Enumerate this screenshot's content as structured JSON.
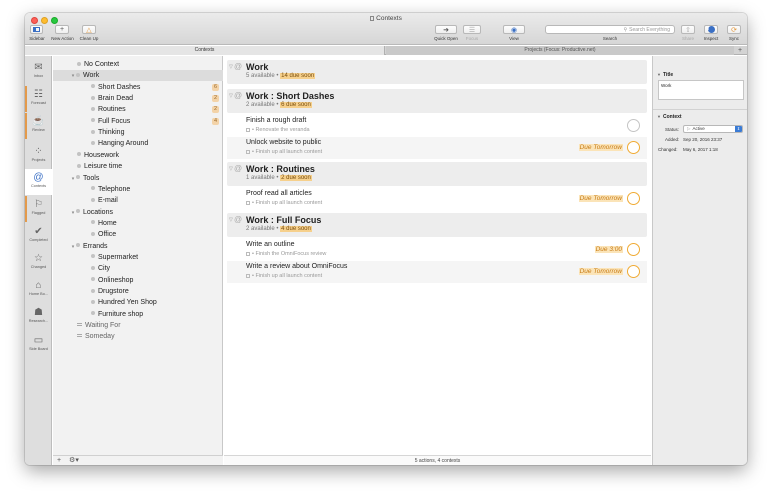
{
  "window": {
    "title": "Contexts"
  },
  "toolbar": {
    "sidebar_label": "Sidebar",
    "new_action_label": "New Action",
    "clean_up_label": "Clean Up",
    "quick_open_label": "Quick Open",
    "focus_label": "Focus",
    "view_label": "View",
    "search_placeholder": "Search Everything",
    "search_label": "Search",
    "share_label": "Share",
    "inspect_label": "Inspect",
    "sync_label": "Sync"
  },
  "tabs": {
    "active": "Contexts",
    "inactive": "Projects (Focus: Productive.net)"
  },
  "perspectives": [
    {
      "label": "Inbox",
      "icon": "inbox-icon",
      "glyph": "✉"
    },
    {
      "label": "Forecast",
      "icon": "forecast-icon",
      "glyph": "☷"
    },
    {
      "label": "Review",
      "icon": "review-icon",
      "glyph": "☕"
    },
    {
      "label": "Projects",
      "icon": "projects-icon",
      "glyph": "⁘"
    },
    {
      "label": "Contexts",
      "icon": "contexts-icon",
      "glyph": "@"
    },
    {
      "label": "Flagged",
      "icon": "flag-icon",
      "glyph": "⚐"
    },
    {
      "label": "Completed",
      "icon": "completed-icon",
      "glyph": "✔"
    },
    {
      "label": "Changed",
      "icon": "changed-icon",
      "glyph": "☆"
    },
    {
      "label": "Home Bo...",
      "icon": "home-icon",
      "glyph": "⌂"
    },
    {
      "label": "Research...",
      "icon": "research-icon",
      "glyph": "☗"
    },
    {
      "label": "Side Board",
      "icon": "sideboard-icon",
      "glyph": "▭"
    }
  ],
  "sidebar": {
    "items": [
      {
        "label": "No Context",
        "level": 0,
        "kind": "bullet",
        "count": ""
      },
      {
        "label": "Work",
        "level": 0,
        "kind": "tri",
        "count": ""
      },
      {
        "label": "Short Dashes",
        "level": 1,
        "kind": "bullet",
        "count": "6"
      },
      {
        "label": "Brain Dead",
        "level": 1,
        "kind": "bullet",
        "count": "2"
      },
      {
        "label": "Routines",
        "level": 1,
        "kind": "bullet",
        "count": "2"
      },
      {
        "label": "Full Focus",
        "level": 1,
        "kind": "bullet",
        "count": "4"
      },
      {
        "label": "Thinking",
        "level": 1,
        "kind": "bullet",
        "count": ""
      },
      {
        "label": "Hanging Around",
        "level": 1,
        "kind": "bullet",
        "count": ""
      },
      {
        "label": "Housework",
        "level": 0,
        "kind": "bullet",
        "count": ""
      },
      {
        "label": "Leisure time",
        "level": 0,
        "kind": "bullet",
        "count": ""
      },
      {
        "label": "Tools",
        "level": 0,
        "kind": "tri",
        "count": ""
      },
      {
        "label": "Telephone",
        "level": 1,
        "kind": "bullet",
        "count": ""
      },
      {
        "label": "E-mail",
        "level": 1,
        "kind": "bullet",
        "count": ""
      },
      {
        "label": "Locations",
        "level": 0,
        "kind": "tri",
        "count": ""
      },
      {
        "label": "Home",
        "level": 1,
        "kind": "bullet",
        "count": ""
      },
      {
        "label": "Office",
        "level": 1,
        "kind": "bullet",
        "count": ""
      },
      {
        "label": "Errands",
        "level": 0,
        "kind": "tri",
        "count": ""
      },
      {
        "label": "Supermarket",
        "level": 1,
        "kind": "bullet",
        "count": ""
      },
      {
        "label": "City",
        "level": 1,
        "kind": "bullet",
        "count": ""
      },
      {
        "label": "Onlineshop",
        "level": 1,
        "kind": "bullet",
        "count": ""
      },
      {
        "label": "Drugstore",
        "level": 1,
        "kind": "bullet",
        "count": ""
      },
      {
        "label": "Hundred Yen Shop",
        "level": 1,
        "kind": "bullet",
        "count": ""
      },
      {
        "label": "Furniture shop",
        "level": 1,
        "kind": "bullet",
        "count": ""
      },
      {
        "label": "Waiting For",
        "level": 0,
        "kind": "square",
        "count": ""
      },
      {
        "label": "Someday",
        "level": 0,
        "kind": "square",
        "count": ""
      }
    ],
    "footer_add": "+",
    "footer_gear": "⚙▾"
  },
  "main": {
    "groups": [
      {
        "title": "Work",
        "available": "5 available •",
        "due": "14 due soon",
        "actions": []
      },
      {
        "title": "Work : Short Dashes",
        "available": "2 available •",
        "due": "6 due soon",
        "actions": [
          {
            "title": "Finish a rough draft",
            "note": "• Renovate the veranda",
            "due": ""
          },
          {
            "title": "Unlock website to public",
            "note": "• Finish up all launch content",
            "due": "Due Tomorrow"
          }
        ]
      },
      {
        "title": "Work : Routines",
        "available": "1 available •",
        "due": "2 due soon",
        "actions": [
          {
            "title": "Proof read all articles",
            "note": "• Finish up all launch content",
            "due": "Due Tomorrow"
          }
        ]
      },
      {
        "title": "Work : Full Focus",
        "available": "2 available •",
        "due": "4 due soon",
        "actions": [
          {
            "title": "Write an outline",
            "note": "• Finish the OmniFocus review",
            "due": "Due 3:00"
          },
          {
            "title": "Write a review about OmniFocus",
            "note": "• Finish up all launch content",
            "due": "Due Tomorrow"
          }
        ]
      }
    ],
    "status": "5 actions, 4 contexts"
  },
  "inspector": {
    "title_header": "Title",
    "title_value": "Work",
    "context_header": "Context",
    "status_label": "Status:",
    "status_value": "Active",
    "added_label": "Added:",
    "added_value": "Sep 20, 2016 23:37",
    "changed_label": "Changed:",
    "changed_value": "May 6, 2017 1:18"
  },
  "colors": {
    "due_badge": "#f6d08c",
    "due_text": "#c77b15",
    "count_badge": "#f3d3a8",
    "accent_blue": "#3a7bd5"
  }
}
